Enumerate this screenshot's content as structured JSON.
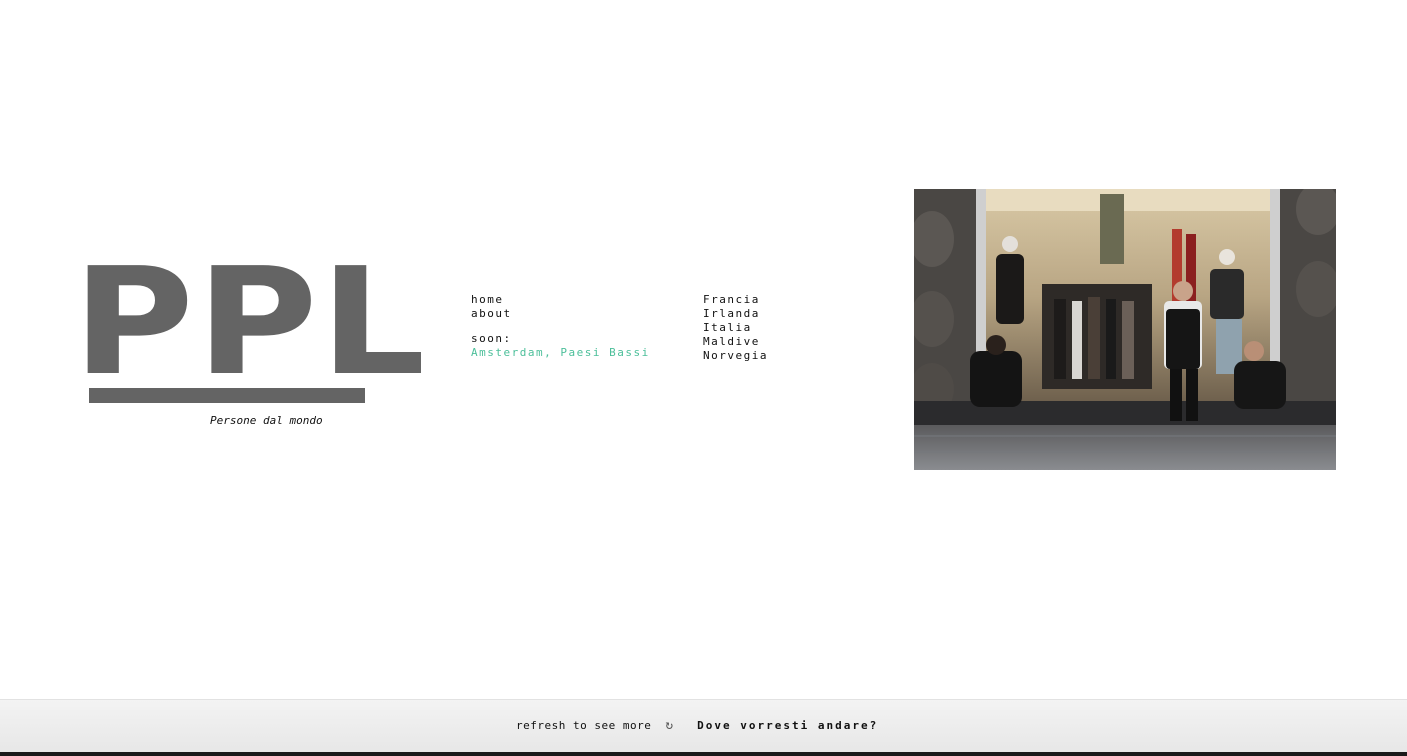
{
  "logo": {
    "text": "PPL",
    "tagline": "Persone dal mondo"
  },
  "nav": {
    "home": "home",
    "about": "about",
    "soon_label": "soon:",
    "soon_destination": "Amsterdam, Paesi Bassi"
  },
  "countries": [
    "Francia",
    "Irlanda",
    "Italia",
    "Maldive",
    "Norvegia"
  ],
  "footer": {
    "refresh_label": "refresh to see more",
    "refresh_icon": "refresh-icon",
    "cta": "Dove vorresti andare?"
  },
  "colors": {
    "logo": "#646464",
    "accent": "#4cbf9a",
    "footer_bg": "#ececec"
  }
}
